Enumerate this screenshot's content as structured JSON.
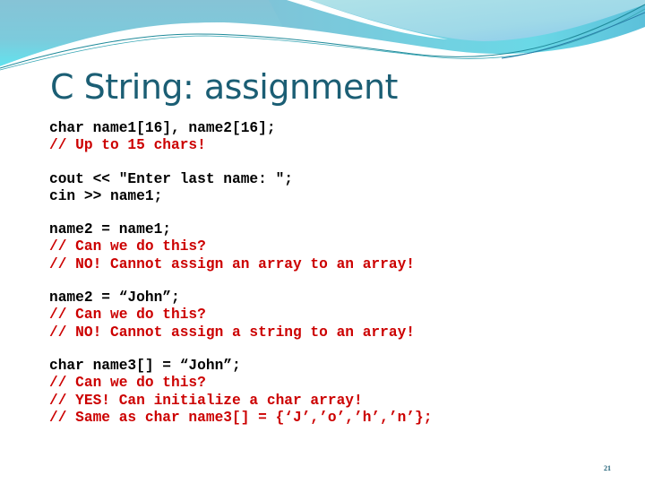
{
  "slide": {
    "title": "C String: assignment",
    "page_number": "21",
    "colors": {
      "title": "#1b5e74",
      "code": "#000000",
      "comment": "#cc0000",
      "wave_light": "#a8dde6",
      "wave_mid": "#7fc4d8",
      "wave_cyan": "#5fdbe8",
      "wave_line": "#1f8a9a"
    }
  },
  "code_blocks": [
    {
      "lines": [
        {
          "type": "stmt",
          "text": "char name1[16], name2[16];"
        },
        {
          "type": "comment",
          "text": "// Up to 15 chars!"
        }
      ]
    },
    {
      "lines": [
        {
          "type": "stmt",
          "text": "cout << \"Enter last name: \";"
        },
        {
          "type": "stmt",
          "text": "cin >> name1;"
        }
      ]
    },
    {
      "lines": [
        {
          "type": "stmt",
          "text": "name2 = name1;"
        },
        {
          "type": "comment",
          "text": "// Can we do this?"
        },
        {
          "type": "comment",
          "text": "// NO! Cannot assign an array to an array!"
        }
      ]
    },
    {
      "lines": [
        {
          "type": "stmt",
          "text": "name2 = “John”;"
        },
        {
          "type": "comment",
          "text": "// Can we do this?"
        },
        {
          "type": "comment",
          "text": "// NO! Cannot assign a string to an array!"
        }
      ]
    },
    {
      "lines": [
        {
          "type": "stmt",
          "text": "char name3[] = “John”;"
        },
        {
          "type": "comment",
          "text": "// Can we do this?"
        },
        {
          "type": "comment",
          "text": "// YES! Can initialize a char array!"
        },
        {
          "type": "comment",
          "text": "// Same as char name3[] = {‘J’,’o’,’h’,’n’};"
        }
      ]
    }
  ]
}
